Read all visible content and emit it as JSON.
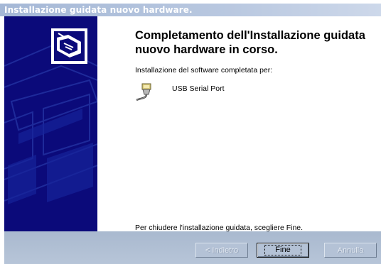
{
  "window": {
    "title": "Installazione guidata nuovo hardware."
  },
  "content": {
    "heading": "Completamento dell'Installazione guidata nuovo hardware in corso.",
    "subtitle": "Installazione del software completata per:",
    "device_icon": "serial-port-icon",
    "device_name": "USB Serial Port",
    "footer": "Per chiudere l'installazione guidata, scegliere Fine."
  },
  "buttons": {
    "back_label": "< Indietro",
    "finish_label": "Fine",
    "cancel_label": "Annulla"
  },
  "colors": {
    "banner": "#0b0a7a",
    "button_bar": "#b4c2d6",
    "titlebar": "#b9c8e0"
  }
}
